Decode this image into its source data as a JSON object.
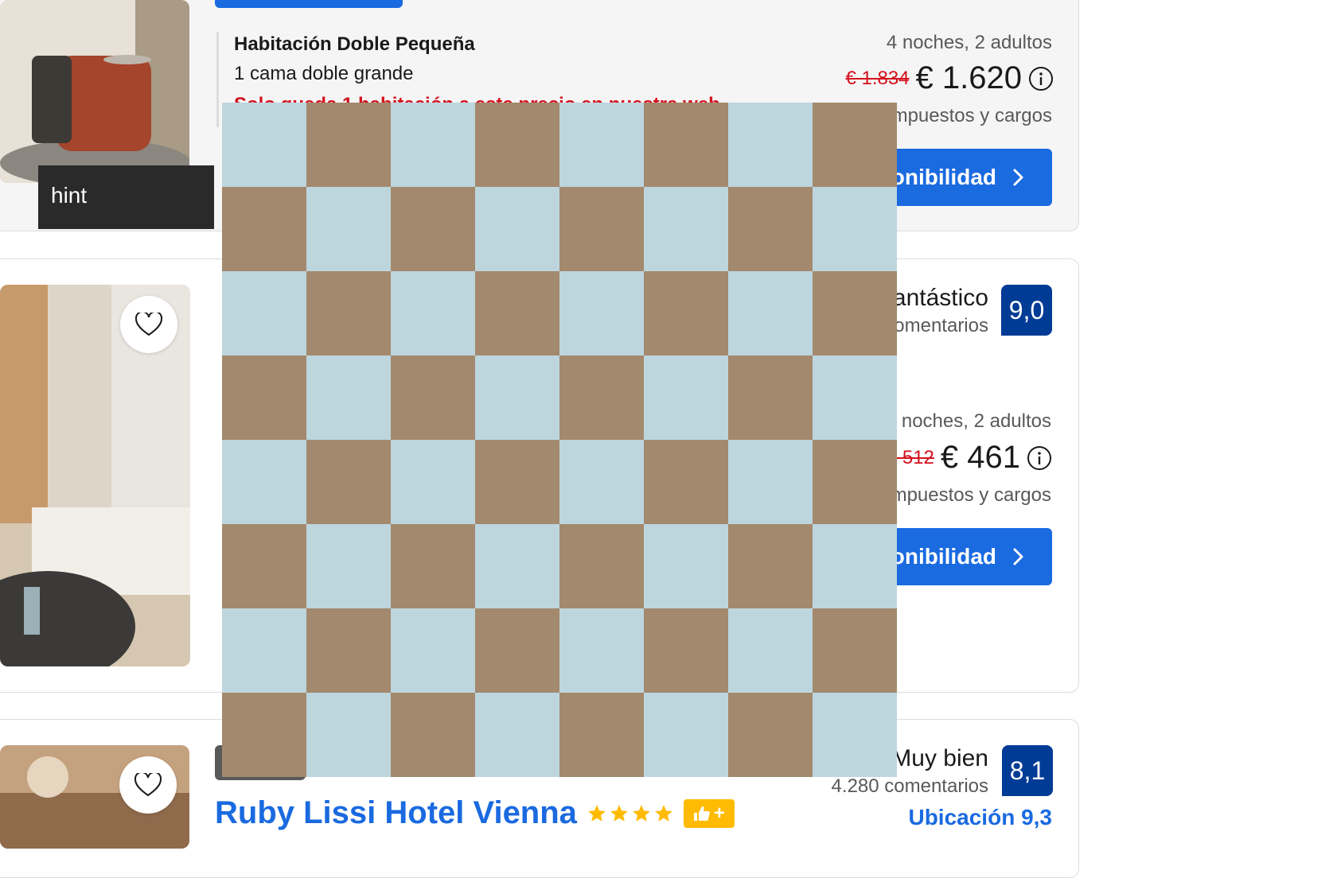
{
  "listing1": {
    "room_name": "Habitación Doble Pequeña",
    "bed": "1 cama doble grande",
    "warning": "Solo queda 1 habitación a este precio en nuestra web",
    "stay": "4 noches, 2 adultos",
    "old_price": "€ 1.834",
    "price": "€ 1.620",
    "taxes": "Incluye impuestos y cargos",
    "button": "Ver disponibilidad"
  },
  "tooltip": {
    "text": "hint"
  },
  "listing2": {
    "review_word": "Fantástico",
    "reviews_count": "comentarios",
    "score": "9,0",
    "stay": "4 noches, 2 adultos",
    "old_price": "€ 512",
    "price": "€ 461",
    "taxes": "Incluye impuestos y cargos",
    "button": "Ver disponibilidad"
  },
  "listing3": {
    "hotel_name": "Ruby Lissi Hotel Vienna",
    "review_word": "Muy bien",
    "reviews_count": "4.280 comentarios",
    "score": "8,1",
    "location": "Ubicación 9,3"
  },
  "icons": [
    "heart-icon",
    "info-icon",
    "chevron-right-icon",
    "star-icon",
    "thumbs-up-icon"
  ],
  "colors": {
    "brand_blue": "#1a6ae0",
    "score_blue": "#003b95",
    "strike_red": "#d4111e",
    "star_yellow": "#febb02",
    "checker_light": "#bdd6de",
    "checker_dark": "#a3896d"
  }
}
